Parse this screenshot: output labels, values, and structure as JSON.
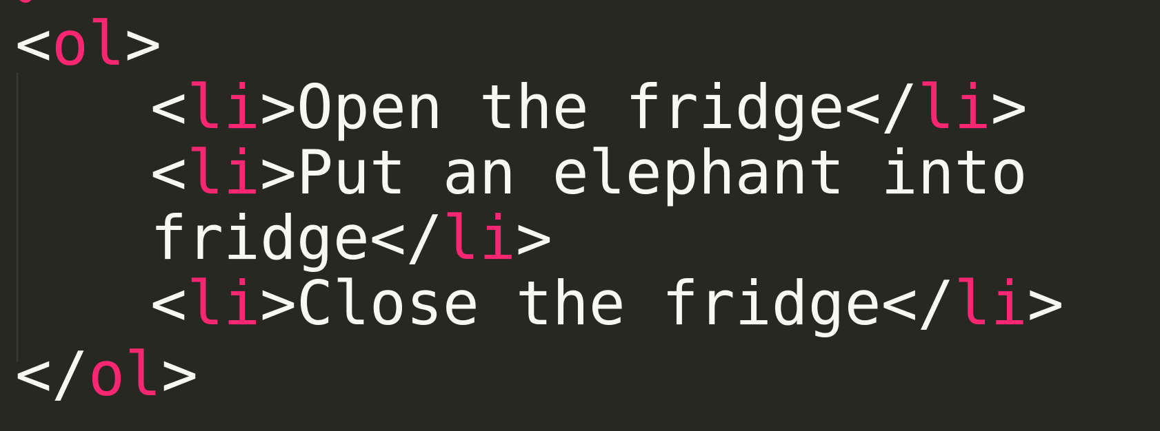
{
  "colors": {
    "background": "#272822",
    "tag_name": "#f92672",
    "text": "#f8f8f2",
    "indent_guide": "#3b3c35"
  },
  "code": {
    "open_ol": {
      "lt": "<",
      "name": "ol",
      "gt": ">"
    },
    "items": [
      {
        "open_lt": "<",
        "open_name": "li",
        "open_gt": ">",
        "text": "Open the fridge",
        "close_lt": "</",
        "close_name": "li",
        "close_gt": ">"
      },
      {
        "open_lt": "<",
        "open_name": "li",
        "open_gt": ">",
        "text_line1": "Put an elephant into",
        "text_line2": "fridge",
        "close_lt": "</",
        "close_name": "li",
        "close_gt": ">"
      },
      {
        "open_lt": "<",
        "open_name": "li",
        "open_gt": ">",
        "text": "Close the fridge",
        "close_lt": "</",
        "close_name": "li",
        "close_gt": ">"
      }
    ],
    "close_ol": {
      "lt": "</",
      "name": "ol",
      "gt": ">"
    }
  }
}
